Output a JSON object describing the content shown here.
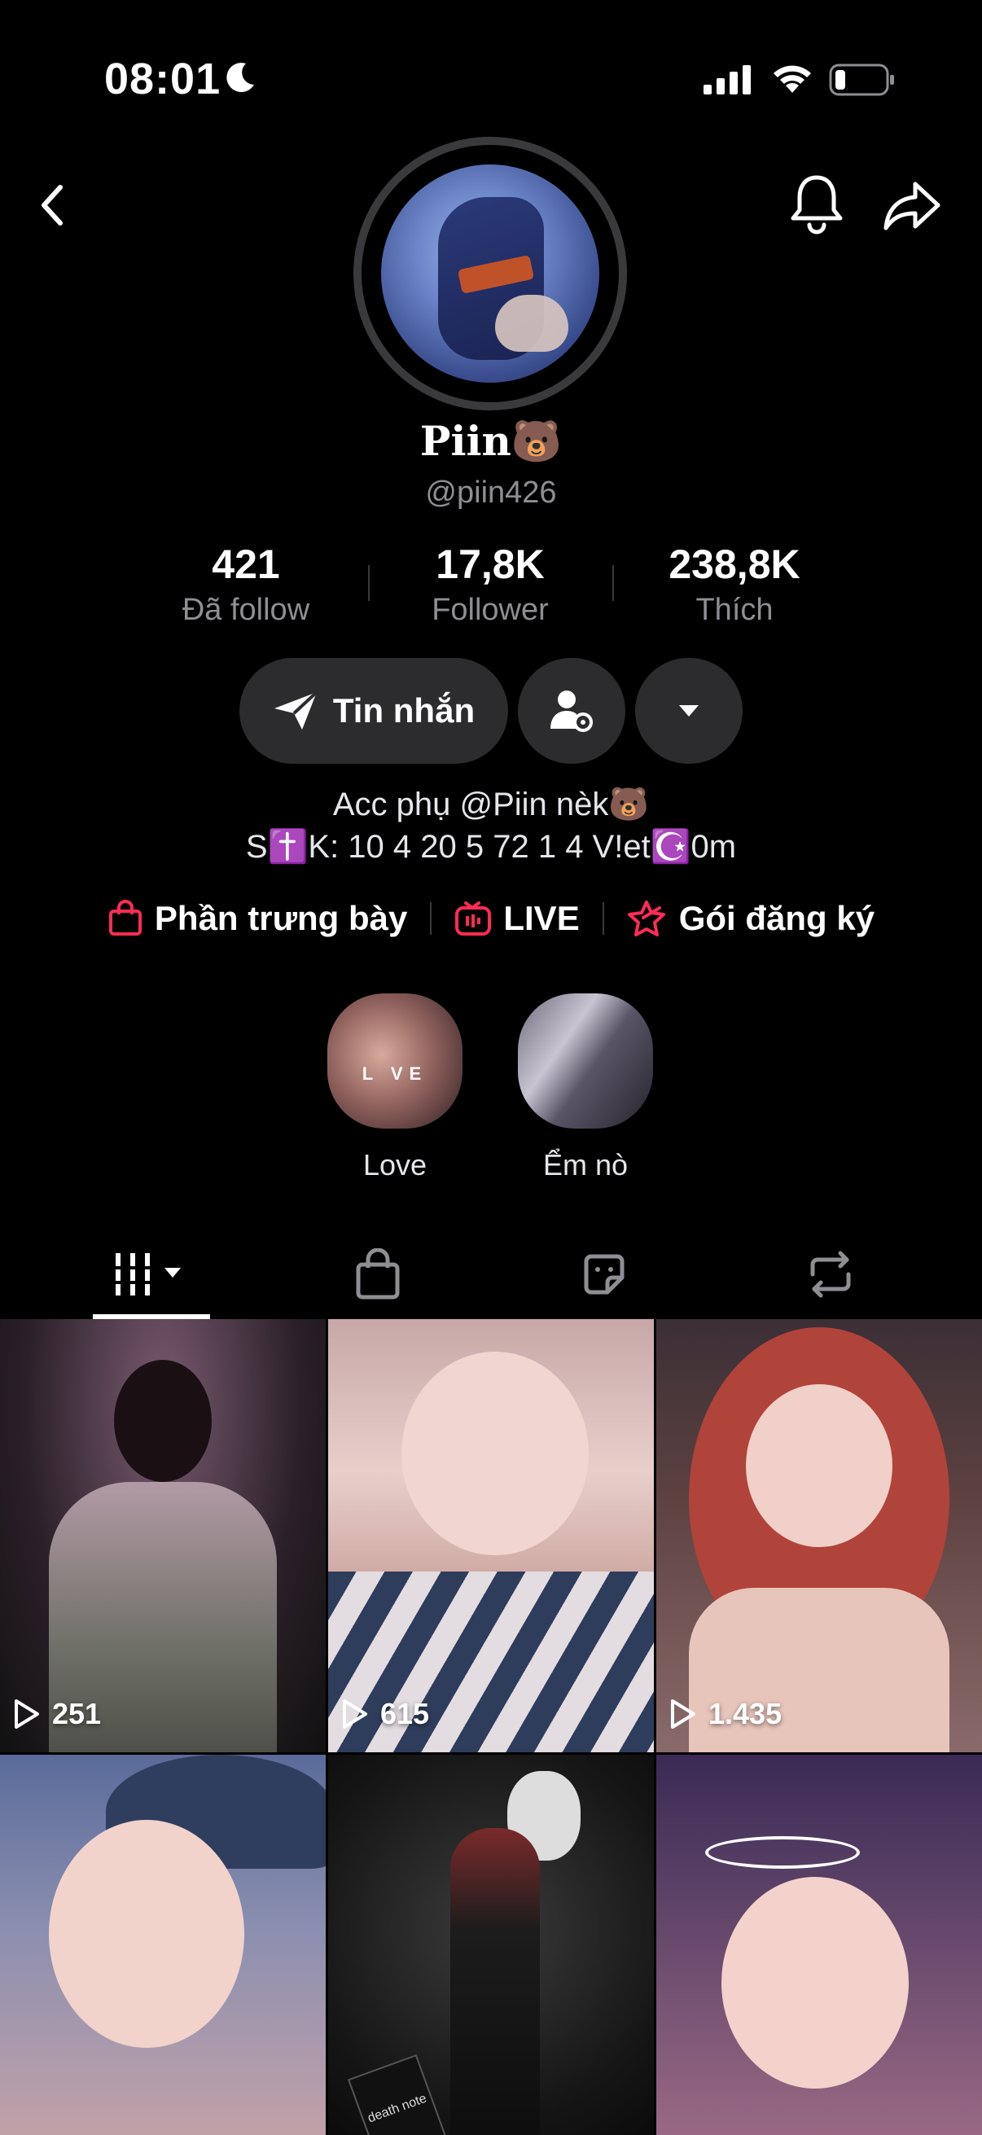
{
  "status_bar": {
    "time": "08:01"
  },
  "profile": {
    "display_name": "Piin🐻",
    "handle": "@piin426",
    "stats": [
      {
        "value": "421",
        "label": "Đã follow"
      },
      {
        "value": "17,8K",
        "label": "Follower"
      },
      {
        "value": "238,8K",
        "label": "Thích"
      }
    ],
    "buttons": {
      "message": "Tin nhắn"
    },
    "bio_line1": "Acc phụ @Piin nèk🐻",
    "bio_line2": "S✝️K: 10 4 20 5 72 1 4 V!et☪️0m",
    "links": [
      {
        "label": "Phần trưng bày",
        "icon": "shopping-bag-icon"
      },
      {
        "label": "LIVE",
        "icon": "live-tv-icon"
      },
      {
        "label": "Gói đăng ký",
        "icon": "subscription-star-icon"
      }
    ],
    "highlights": [
      {
        "caption": "Love",
        "overlay": "L  VE"
      },
      {
        "caption": "Ểm nò"
      }
    ]
  },
  "tabs": [
    {
      "name": "videos-tab",
      "icon": "grid-icon"
    },
    {
      "name": "shop-tab",
      "icon": "bag-icon"
    },
    {
      "name": "stickers-tab",
      "icon": "sticker-icon"
    },
    {
      "name": "reposts-tab",
      "icon": "repost-icon"
    }
  ],
  "videos": [
    {
      "views": "251"
    },
    {
      "views": "615"
    },
    {
      "views": "1.435"
    },
    {
      "views": ""
    },
    {
      "views": "",
      "overlay_text": "death note"
    },
    {
      "views": ""
    }
  ],
  "colors": {
    "background": "#000000",
    "accent": "#fe2c55",
    "secondary_text": "#8e8e93",
    "button_bg": "#2c2c2e"
  }
}
